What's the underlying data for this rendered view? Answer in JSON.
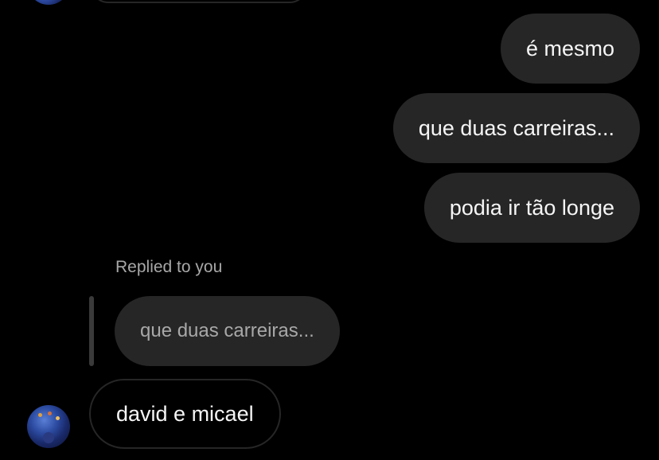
{
  "conversation": {
    "outgoing": [
      {
        "text": "é mesmo"
      },
      {
        "text": "que duas carreiras..."
      },
      {
        "text": "podia ir tão longe"
      }
    ],
    "reply": {
      "label": "Replied to you",
      "quoted_text": "que duas carreiras...",
      "message": "david e micael"
    }
  },
  "colors": {
    "background": "#000000",
    "bubble": "#262626",
    "text_primary": "#f5f5f5",
    "text_secondary": "#a8a8a8"
  }
}
